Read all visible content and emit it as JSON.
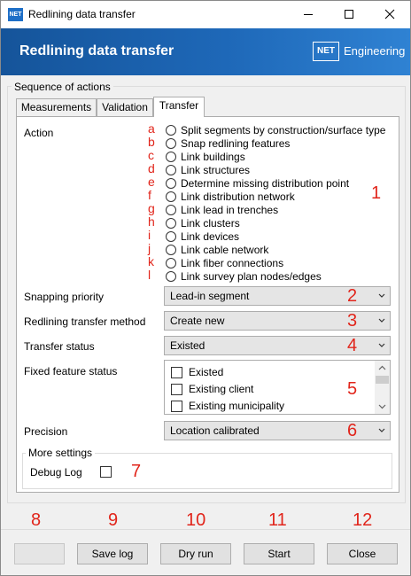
{
  "window": {
    "title": "Redlining data transfer",
    "app_icon_text": "NET",
    "controls": [
      "minimize-icon",
      "maximize-icon",
      "close-icon"
    ]
  },
  "banner": {
    "title": "Redlining data transfer",
    "logo_text": "NET",
    "brand": "Engineering"
  },
  "group": {
    "legend": "Sequence of actions"
  },
  "tabs": [
    {
      "label": "Measurements",
      "active": false
    },
    {
      "label": "Validation",
      "active": false
    },
    {
      "label": "Transfer",
      "active": true
    }
  ],
  "action": {
    "label": "Action",
    "marker": "1",
    "options": [
      {
        "letter": "a",
        "label": "Split segments by construction/surface type"
      },
      {
        "letter": "b",
        "label": "Snap redlining features"
      },
      {
        "letter": "c",
        "label": "Link buildings"
      },
      {
        "letter": "d",
        "label": "Link structures"
      },
      {
        "letter": "e",
        "label": "Determine missing distribution point"
      },
      {
        "letter": "f",
        "label": "Link distribution network"
      },
      {
        "letter": "g",
        "label": "Link lead in trenches"
      },
      {
        "letter": "h",
        "label": "Link clusters"
      },
      {
        "letter": "i",
        "label": "Link devices"
      },
      {
        "letter": "j",
        "label": "Link cable network"
      },
      {
        "letter": "k",
        "label": "Link fiber connections"
      },
      {
        "letter": "l",
        "label": "Link survey plan nodes/edges"
      }
    ]
  },
  "fields": {
    "snapping_priority": {
      "label": "Snapping priority",
      "value": "Lead-in segment",
      "marker": "2"
    },
    "transfer_method": {
      "label": "Redlining transfer method",
      "value": "Create new",
      "marker": "3"
    },
    "transfer_status": {
      "label": "Transfer status",
      "value": "Existed",
      "marker": "4"
    },
    "fixed_status": {
      "label": "Fixed feature status",
      "marker": "5",
      "items": [
        "Existed",
        "Existing client",
        "Existing municipality"
      ]
    },
    "precision": {
      "label": "Precision",
      "value": "Location calibrated",
      "marker": "6"
    }
  },
  "more_settings": {
    "legend": "More settings",
    "debug_label": "Debug Log",
    "marker": "7"
  },
  "footer": {
    "markers": [
      "8",
      "9",
      "10",
      "11",
      "12"
    ],
    "buttons": [
      {
        "label": "",
        "enabled": false
      },
      {
        "label": "Save log",
        "enabled": true
      },
      {
        "label": "Dry run",
        "enabled": true
      },
      {
        "label": "Start",
        "enabled": true
      },
      {
        "label": "Close",
        "enabled": true
      }
    ]
  },
  "colors": {
    "accent_red": "#e1251b",
    "banner_dark": "#15549a",
    "banner_light": "#2f82d3"
  }
}
